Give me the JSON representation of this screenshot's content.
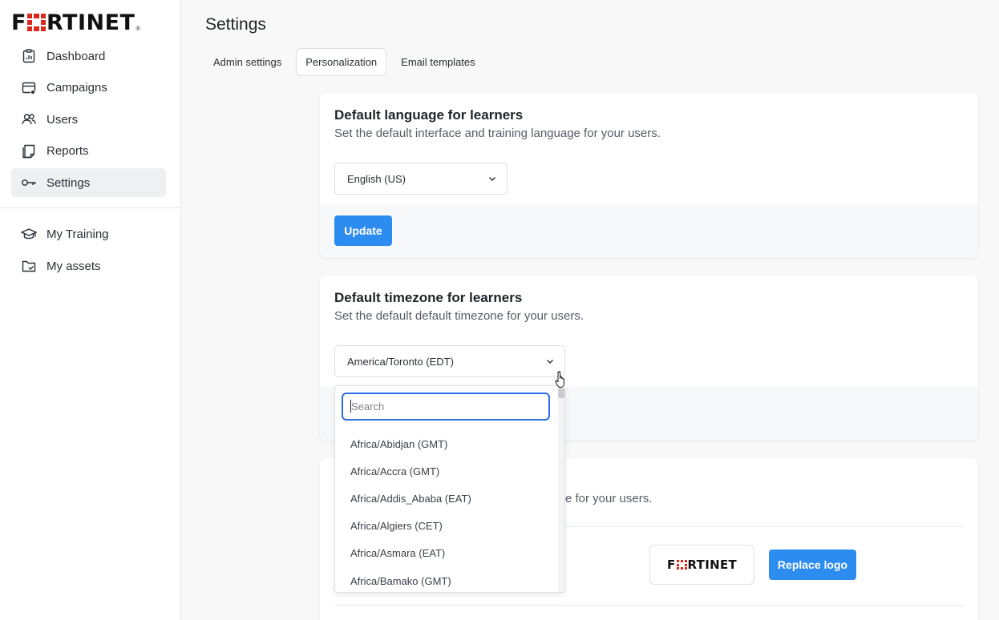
{
  "brand": {
    "logo_text_pre": "F",
    "logo_text_post": "RTINET",
    "reg": "®",
    "accent": "#da291c"
  },
  "sidebar": {
    "items": [
      {
        "label": "Dashboard",
        "icon": "dashboard-icon"
      },
      {
        "label": "Campaigns",
        "icon": "campaigns-icon"
      },
      {
        "label": "Users",
        "icon": "users-icon"
      },
      {
        "label": "Reports",
        "icon": "reports-icon"
      },
      {
        "label": "Settings",
        "icon": "key-icon",
        "active": true
      }
    ],
    "secondary": [
      {
        "label": "My Training",
        "icon": "graduation-cap-icon"
      },
      {
        "label": "My assets",
        "icon": "folder-icon"
      }
    ]
  },
  "page": {
    "title": "Settings"
  },
  "tabs": [
    {
      "label": "Admin settings"
    },
    {
      "label": "Personalization",
      "active": true
    },
    {
      "label": "Email templates"
    }
  ],
  "language_card": {
    "title": "Default language for learners",
    "description": "Set the default interface and training language for your users.",
    "selected": "English (US)",
    "button": "Update"
  },
  "timezone_card": {
    "title": "Default timezone for learners",
    "description": "Set the default default timezone for your users.",
    "selected": "America/Toronto (EDT)"
  },
  "timezone_dropdown": {
    "search_placeholder": "Search",
    "options": [
      "Africa/Abidjan (GMT)",
      "Africa/Accra (GMT)",
      "Africa/Addis_Ababa (EAT)",
      "Africa/Algiers (CET)",
      "Africa/Asmara (EAT)",
      "Africa/Bamako (GMT)"
    ]
  },
  "logo_card": {
    "description_partial": "e for your users.",
    "logo_text_pre": "F",
    "logo_text_post": "RTINET",
    "button": "Replace logo"
  },
  "colors": {
    "primary": "#2d8cf0",
    "focus": "#2d6fe0"
  }
}
